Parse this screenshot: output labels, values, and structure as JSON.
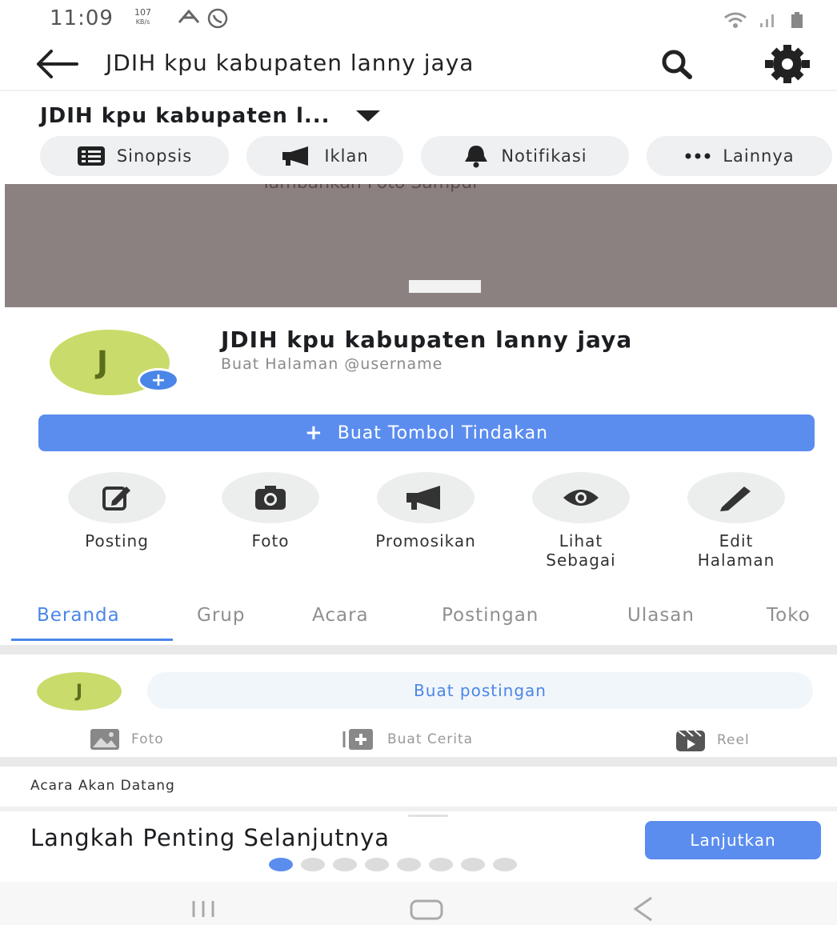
{
  "status_bar": {
    "time": "11:09",
    "speed_value": "107",
    "speed_unit": "KB/s"
  },
  "top_bar": {
    "title": "JDIH kpu kabupaten lanny jaya"
  },
  "page_header": {
    "name_truncated": "JDIH kpu kabupaten l..."
  },
  "chips": [
    {
      "label": "Sinopsis",
      "icon": "list-icon"
    },
    {
      "label": "Iklan",
      "icon": "megaphone-icon"
    },
    {
      "label": "Notifikasi",
      "icon": "bell-icon"
    },
    {
      "label": "Lainnya",
      "icon": "more-icon"
    }
  ],
  "cover": {
    "hint": "Tambahkan Foto Sampul"
  },
  "profile": {
    "initial": "J",
    "name": "JDIH kpu kabupaten lanny jaya",
    "username_prompt": "Buat Halaman @username",
    "add_badge": "+"
  },
  "cta": {
    "label": "Buat Tombol Tindakan",
    "plus": "+"
  },
  "actions": [
    {
      "label": "Posting",
      "icon": "edit-square-icon"
    },
    {
      "label": "Foto",
      "icon": "camera-icon"
    },
    {
      "label": "Promosikan",
      "icon": "megaphone-icon"
    },
    {
      "label": "Lihat\nSebagai",
      "icon": "eye-icon"
    },
    {
      "label": "Edit\nHalaman",
      "icon": "pencil-icon"
    }
  ],
  "tabs": [
    {
      "label": "Beranda",
      "active": true
    },
    {
      "label": "Grup",
      "active": false
    },
    {
      "label": "Acara",
      "active": false
    },
    {
      "label": "Postingan",
      "active": false
    },
    {
      "label": "Ulasan",
      "active": false
    },
    {
      "label": "Toko",
      "active": false
    }
  ],
  "composer": {
    "initial": "J",
    "placeholder": "Buat postingan",
    "actions": [
      {
        "label": "Foto",
        "icon": "photo-icon"
      },
      {
        "label": "Buat Cerita",
        "icon": "story-plus-icon"
      },
      {
        "label": "Reel",
        "icon": "reel-icon"
      }
    ]
  },
  "upcoming_events": {
    "label": "Acara Akan Datang"
  },
  "next_steps": {
    "title": "Langkah Penting Selanjutnya",
    "button": "Lanjutkan",
    "dots_total": 8,
    "dots_active_index": 0
  },
  "colors": {
    "accent": "#5b8def",
    "tab_active": "#4a86e8",
    "avatar": "#c9db6a",
    "cover": "#8c8181"
  }
}
